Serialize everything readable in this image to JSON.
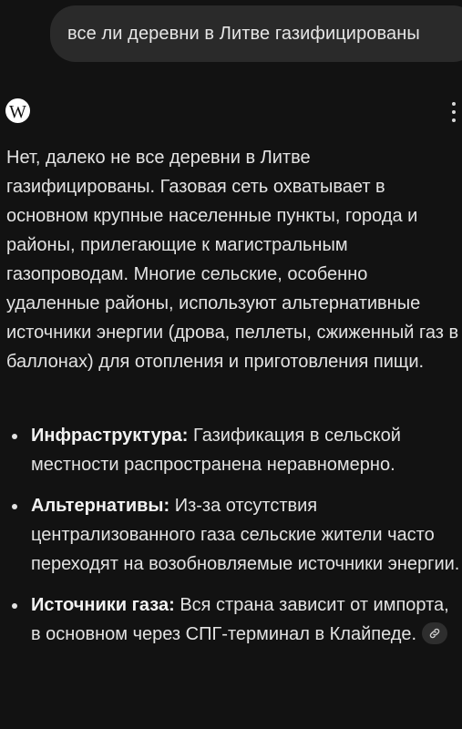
{
  "query": {
    "text": "все ли деревни в Литве газифицированы"
  },
  "source": {
    "icon_letter": "W",
    "icon": "wikipedia-icon",
    "menu_icon": "more-vertical-icon"
  },
  "answer": {
    "intro": "Нет, далеко не все деревни в Литве газифицированы. Газовая сеть охватывает в основном крупные населенные пункты, города и районы, прилегающие к магистральным газопроводам. Многие сельские, особенно удаленные районы, используют альтернативные источники энергии (дрова, пеллеты, сжиженный газ в баллонах) для отопления и приготовления пищи.",
    "bullets": [
      {
        "title": "Инфраструктура:",
        "text": " Газификация в сельской местности распространена неравномерно."
      },
      {
        "title": "Альтернативы:",
        "text": " Из-за отсутствия централизованного газа сельские жители часто переходят на возобновляемые источники энергии."
      },
      {
        "title": "Источники газа:",
        "text": " Вся страна зависит от импорта, в основном через СПГ-терминал в Клайпеде."
      }
    ],
    "link_icon": "link-icon"
  },
  "colors": {
    "background": "#121212",
    "bubble": "#2a2a2a",
    "text": "#e3e3e3"
  }
}
